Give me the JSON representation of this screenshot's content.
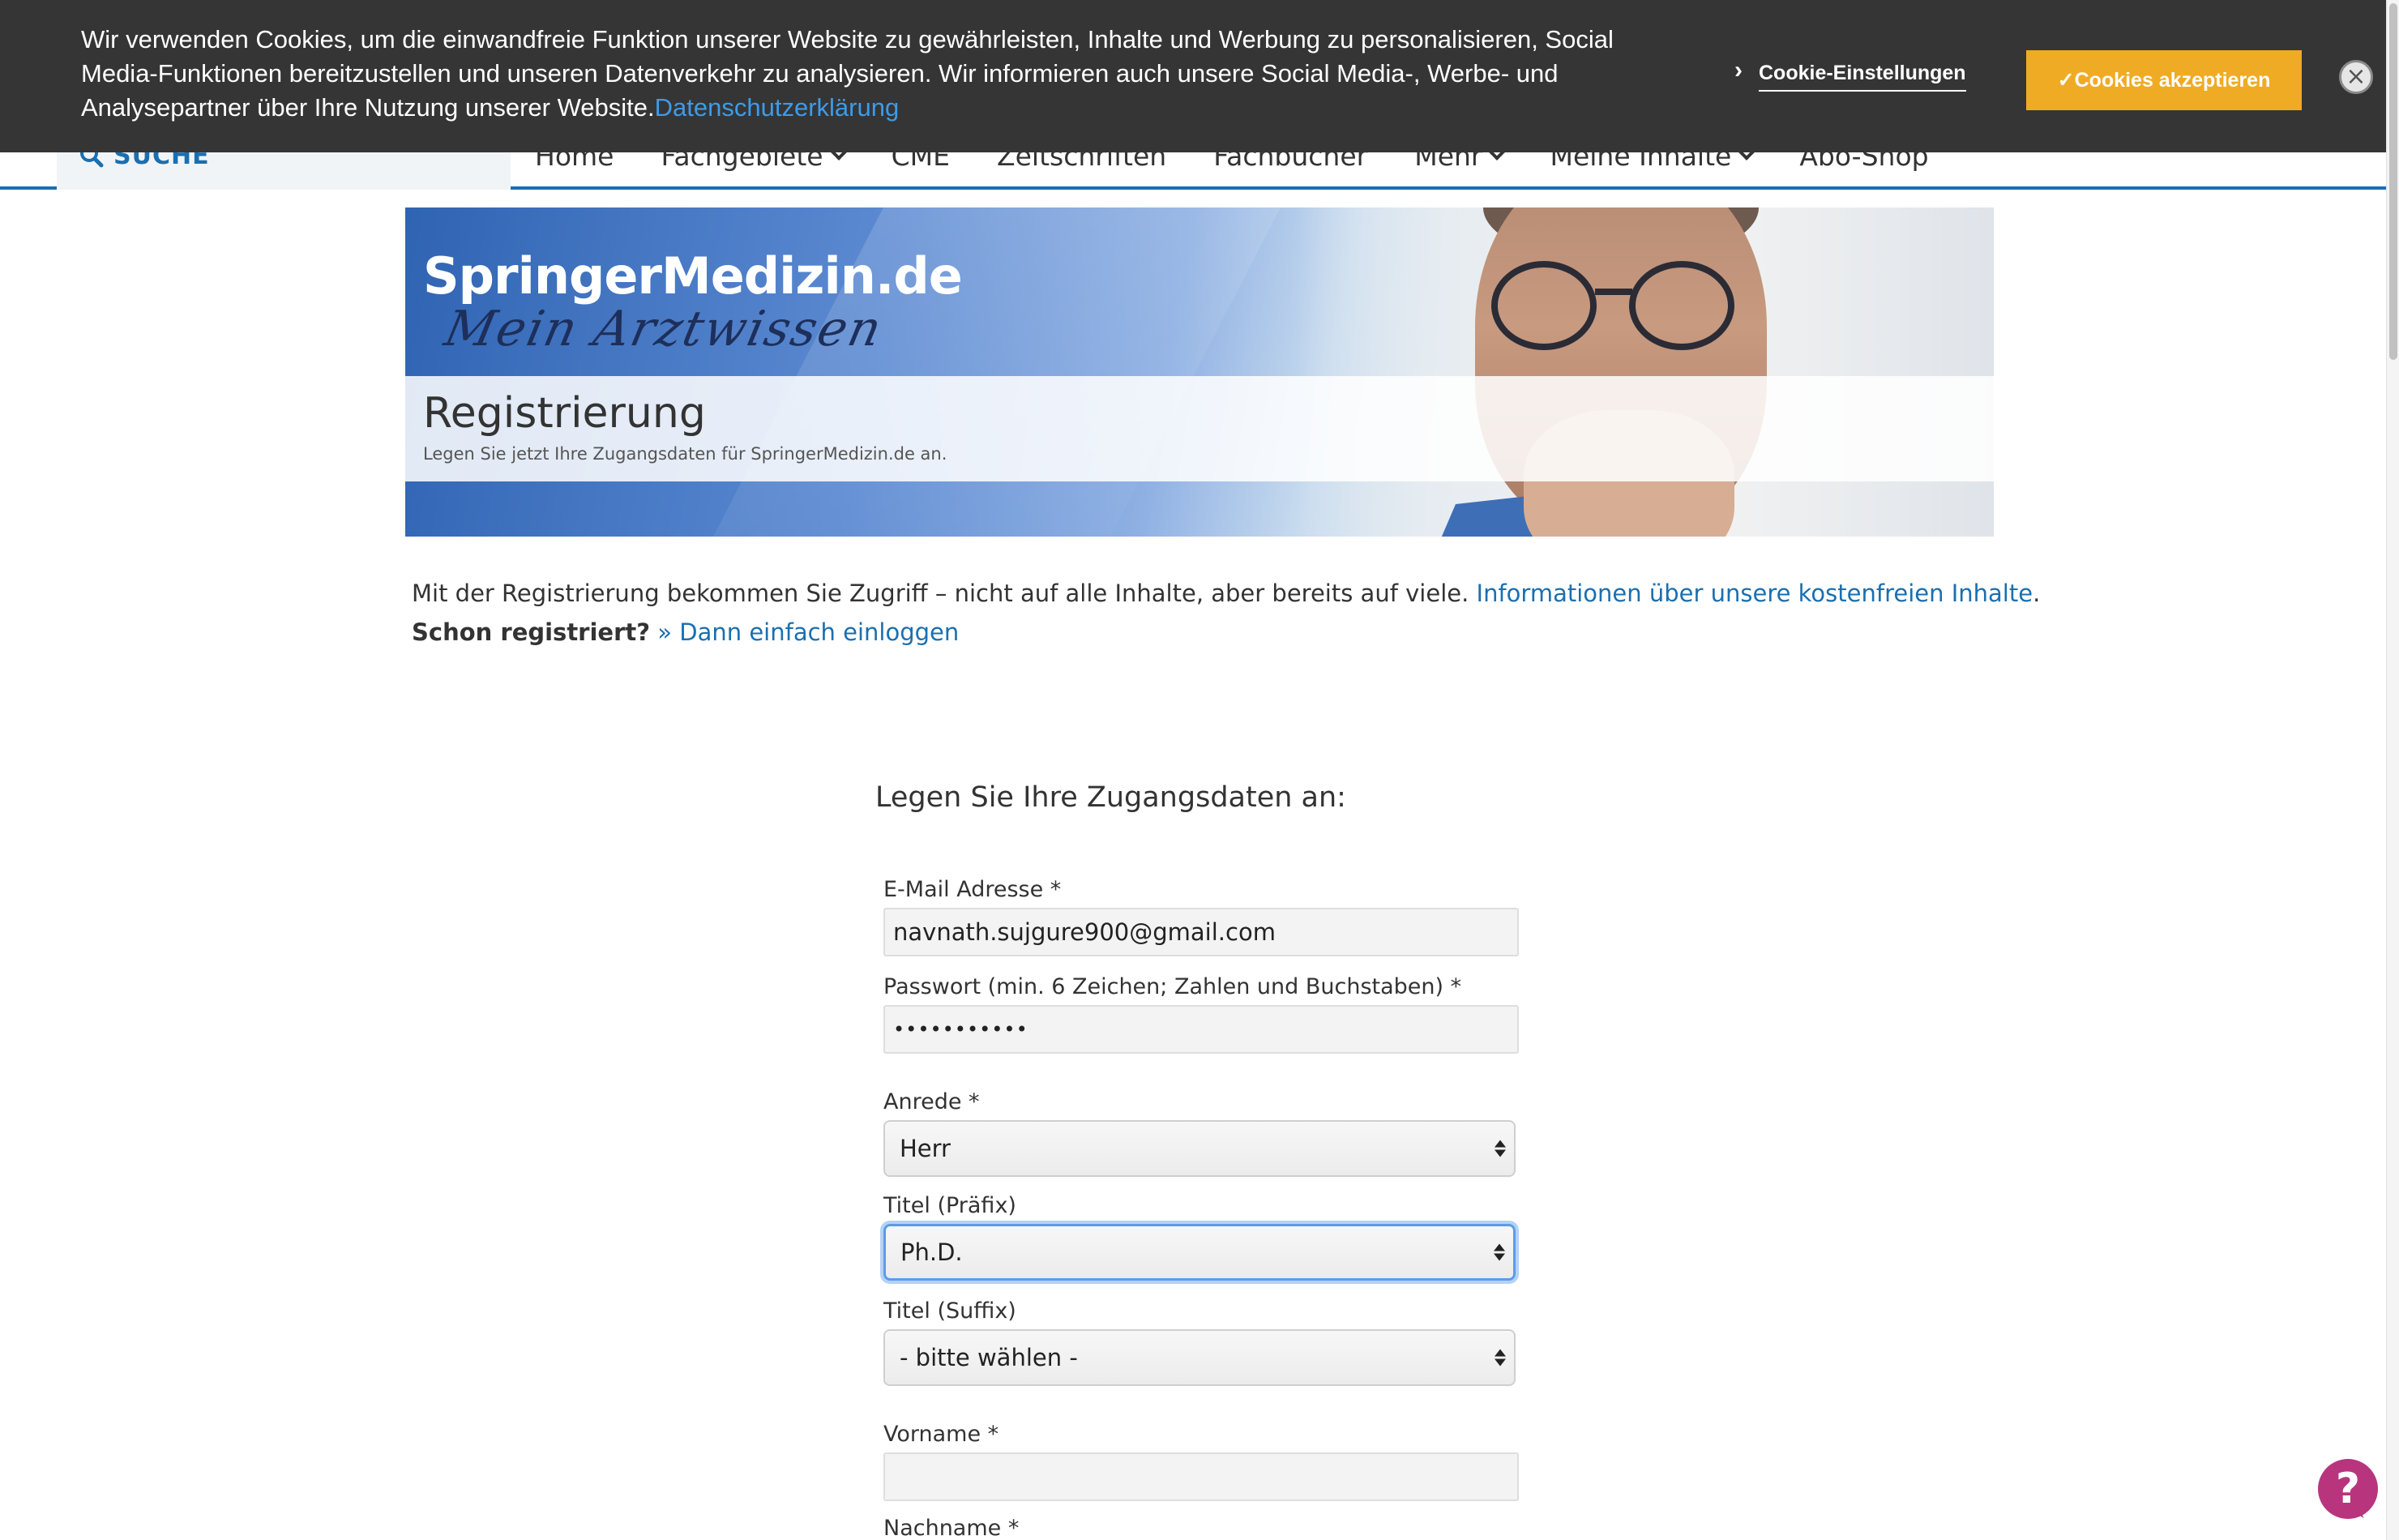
{
  "cookie_banner": {
    "text": "Wir verwenden Cookies, um die einwandfreie Funktion unserer Website zu gewährleisten, Inhalte und Werbung zu personalisieren, Social Media-Funktionen bereitzustellen und unseren Datenverkehr zu analysieren. Wir informieren auch unsere Social Media-, Werbe- und Analysepartner über Ihre Nutzung unserer Website.",
    "privacy_link": "Datenschutzerklärung",
    "settings_label": "Cookie-Einstellungen",
    "accept_label": "✓Cookies akzeptieren",
    "close_icon": "close-icon",
    "accept_color": "#f0ab25"
  },
  "nav": {
    "search_label": "SUCHE",
    "items": [
      {
        "label": "Home",
        "dropdown": false
      },
      {
        "label": "Fachgebiete",
        "dropdown": true
      },
      {
        "label": "CME",
        "dropdown": false
      },
      {
        "label": "Zeitschriften",
        "dropdown": false
      },
      {
        "label": "Fachbücher",
        "dropdown": false
      },
      {
        "label": "Mehr",
        "dropdown": true
      },
      {
        "label": "Meine Inhalte",
        "dropdown": true
      },
      {
        "label": "Abo-Shop",
        "dropdown": false
      }
    ],
    "accent_color": "#1a6fb0"
  },
  "hero": {
    "brand": "SpringerMedizin.de",
    "tagline": "Mein Arztwissen",
    "title": "Registrierung",
    "subtitle": "Legen Sie jetzt Ihre Zugangsdaten für SpringerMedizin.de an."
  },
  "intro": {
    "line1": "Mit der Registrierung bekommen Sie Zugriff – nicht auf alle Inhalte, aber bereits auf viele.",
    "info_link": "Informationen über unsere kostenfreien Inhalte",
    "line1_end": ".",
    "already_registered": "Schon registriert?",
    "login_link": "» Dann einfach einloggen"
  },
  "form": {
    "heading": "Legen Sie Ihre Zugangsdaten an:",
    "email": {
      "label": "E-Mail Adresse *",
      "value": "navnath.sujgure900@gmail.com"
    },
    "password": {
      "label": "Passwort (min. 6 Zeichen; Zahlen und Buchstaben) *",
      "value": "•••••••••••"
    },
    "salutation": {
      "label": "Anrede *",
      "value": "Herr"
    },
    "title_prefix": {
      "label": "Titel (Präfix)",
      "value": "Ph.D."
    },
    "title_suffix": {
      "label": "Titel (Suffix)",
      "value": "- bitte wählen -"
    },
    "first_name": {
      "label": "Vorname *",
      "value": ""
    },
    "last_name": {
      "label": "Nachname *"
    }
  },
  "help": {
    "icon": "help-question-icon",
    "glyph": "?",
    "color": "#b8357e"
  }
}
